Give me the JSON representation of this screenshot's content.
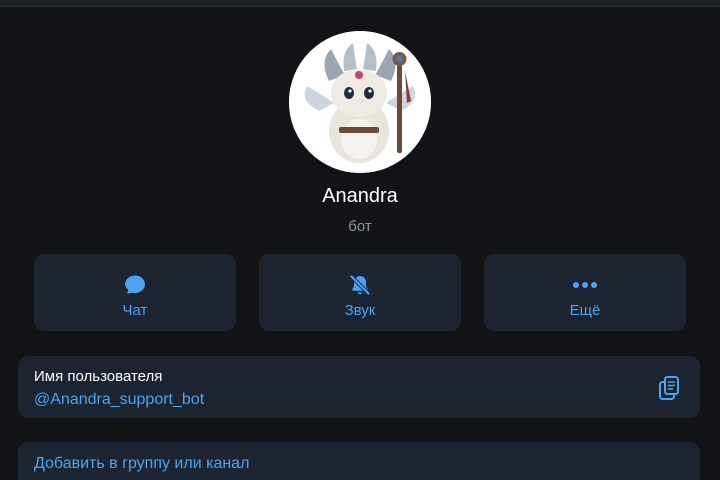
{
  "profile": {
    "name": "Anandra",
    "subtitle": "бот",
    "avatar_icon": "avatar-creature-image"
  },
  "actions": [
    {
      "label": "Чат",
      "icon": "chat-bubble-icon"
    },
    {
      "label": "Звук",
      "icon": "bell-muted-icon"
    },
    {
      "label": "Ещё",
      "icon": "more-dots-icon"
    }
  ],
  "username": {
    "label": "Имя пользователя",
    "value": "@Anandra_support_bot",
    "copy_icon": "copy-icon"
  },
  "add_to_group": {
    "label": "Добавить в группу или канал"
  },
  "colors": {
    "background": "#111317",
    "card": "#1b2430",
    "accent": "#4da3f2",
    "muted_text": "#8e96a3"
  }
}
